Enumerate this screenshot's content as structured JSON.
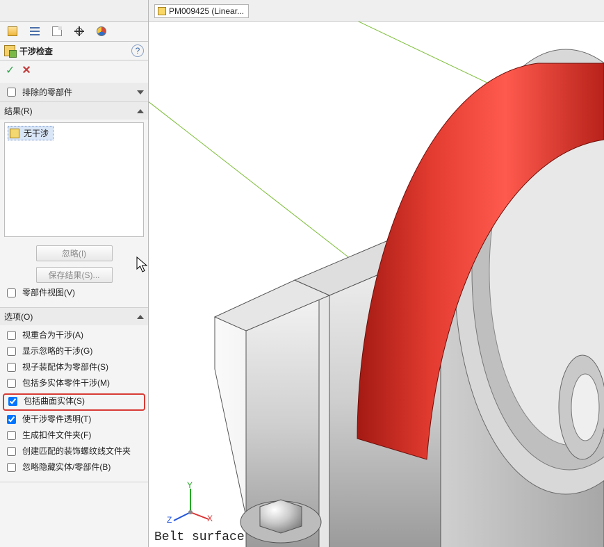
{
  "topbar": {
    "doc_label": "PM009425 (Linear..."
  },
  "tabs": {
    "assembly_tip": "装配体",
    "designtree_tip": "设计树",
    "config_tip": "配置",
    "display_tip": "显示状态",
    "appearance_tip": "外观"
  },
  "feature": {
    "title": "干涉检查",
    "help_glyph": "?"
  },
  "confirm": {
    "ok_glyph": "✓",
    "cancel_glyph": "✕"
  },
  "excluded": {
    "heading": "排除的零部件"
  },
  "results": {
    "heading": "结果(R)",
    "item_label": "无干涉",
    "ignore_btn": "忽略(I)",
    "save_btn": "保存结果(S)...",
    "partview_label": "零部件视图(V)"
  },
  "options": {
    "heading": "选项(O)",
    "opts": [
      {
        "label": "视重合为干涉(A)",
        "checked": false
      },
      {
        "label": "显示忽略的干涉(G)",
        "checked": false
      },
      {
        "label": "视子装配体为零部件(S)",
        "checked": false
      },
      {
        "label": "包括多实体零件干涉(M)",
        "checked": false
      },
      {
        "label": "包括曲面实体(S)",
        "checked": true,
        "highlighted": true
      },
      {
        "label": "使干涉零件透明(T)",
        "checked": true
      },
      {
        "label": "生成扣件文件夹(F)",
        "checked": false
      },
      {
        "label": "创建匹配的装饰螺纹线文件夹",
        "checked": false
      },
      {
        "label": "忽略隐藏实体/零部件(B)",
        "checked": false
      }
    ]
  },
  "triad": {
    "x": "X",
    "y": "Y",
    "z": "Z"
  },
  "viewport": {
    "belt_label": "Belt surface"
  }
}
